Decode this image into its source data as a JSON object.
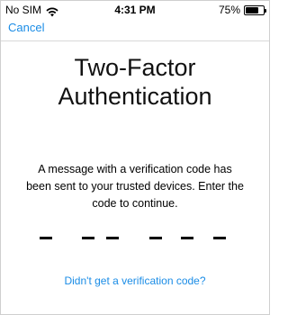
{
  "status_bar": {
    "carrier": "No SIM",
    "time": "4:31 PM",
    "battery_percent": "75%",
    "battery_level": 0.75,
    "wifi_icon": "wifi-icon",
    "battery_icon": "battery-icon"
  },
  "nav": {
    "cancel_label": "Cancel"
  },
  "title": {
    "line1": "Two-Factor",
    "line2": "Authentication"
  },
  "message": {
    "line1": "A message with a verification code has",
    "line2": "been sent to your trusted devices. Enter the",
    "line3": "code to continue."
  },
  "code": {
    "digit_count": 6,
    "values": [
      "",
      "",
      "",
      "",
      "",
      ""
    ]
  },
  "link": {
    "resend_label": "Didn't get a verification code?"
  },
  "colors": {
    "accent": "#1a8ce6",
    "text": "#000000",
    "background": "#ffffff"
  }
}
